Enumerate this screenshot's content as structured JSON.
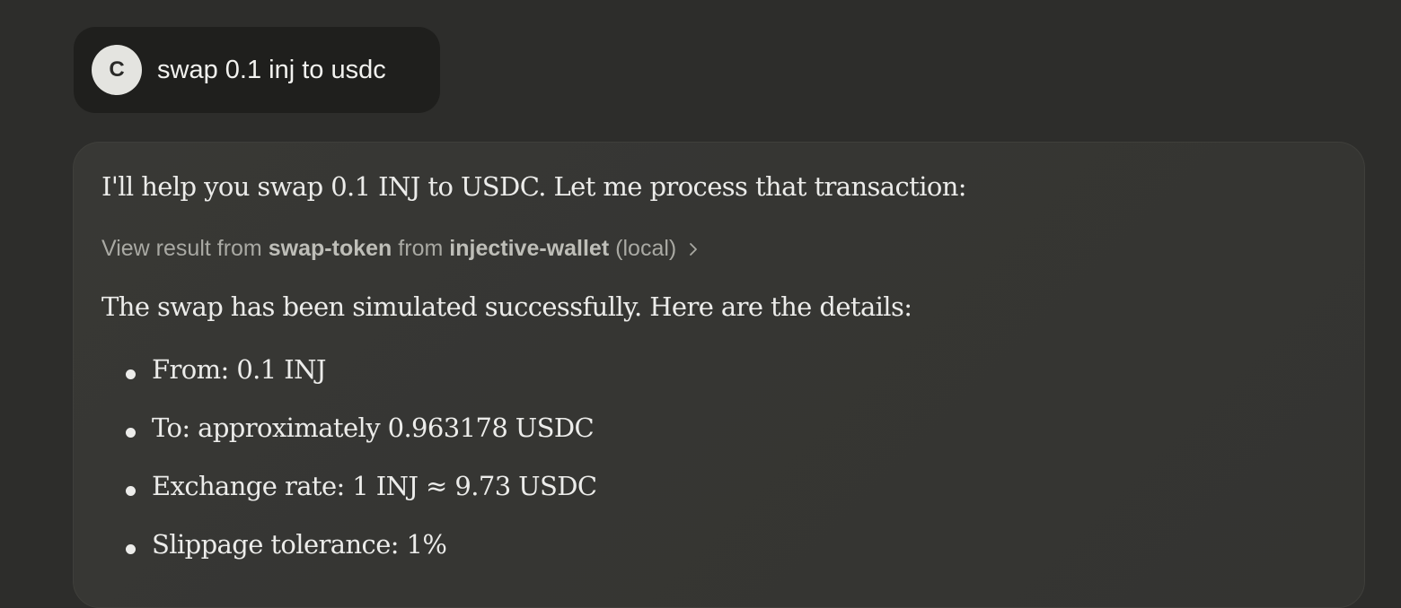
{
  "user_message": {
    "avatar_initial": "C",
    "text": "swap 0.1 inj to usdc"
  },
  "assistant_message": {
    "intro": "I'll help you swap 0.1 INJ to USDC. Let me process that transaction:",
    "tool_result": {
      "prefix": "View result from",
      "tool_name": "swap-token",
      "connector": "from",
      "server_name": "injective-wallet",
      "suffix": "(local)",
      "icon": "chevron-right-icon"
    },
    "summary": "The swap has been simulated successfully. Here are the details:",
    "details": [
      "From: 0.1 INJ",
      "To: approximately 0.963178 USDC",
      "Exchange rate: 1 INJ ≈ 9.73 USDC",
      "Slippage tolerance: 1%"
    ]
  },
  "colors": {
    "background": "#2d2d2b",
    "user_bubble": "#1f1f1d",
    "assistant_card": "#373734",
    "avatar": "#e4e4e0",
    "text": "#ececea",
    "muted_text": "#a9a9a3"
  }
}
